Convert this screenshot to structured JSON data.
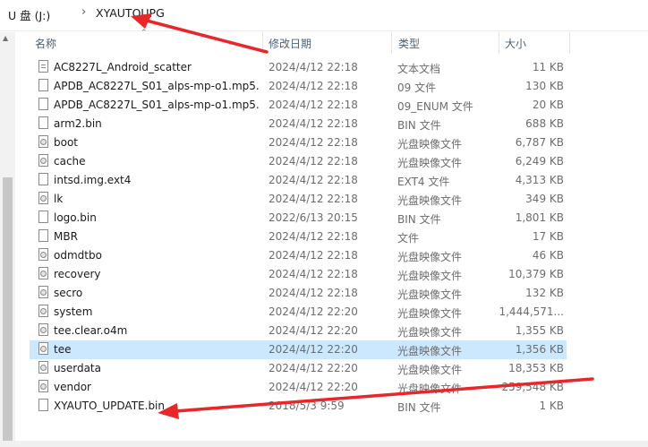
{
  "breadcrumb": {
    "drive": "U 盘 (J:)",
    "separator": "›",
    "folder": "XYAUTOUPG"
  },
  "columns": {
    "name": "名称",
    "date": "修改日期",
    "type": "类型",
    "size": "大小"
  },
  "files": [
    {
      "name": "AC8227L_Android_scatter",
      "date": "2024/4/12 22:18",
      "type": "文本文档",
      "size": "11 KB",
      "icon": "text-doc-icon"
    },
    {
      "name": "APDB_AC8227L_S01_alps-mp-o1.mp5...",
      "date": "2024/4/12 22:18",
      "type": "09 文件",
      "size": "130 KB",
      "icon": "file-icon"
    },
    {
      "name": "APDB_AC8227L_S01_alps-mp-o1.mp5...",
      "date": "2024/4/12 22:18",
      "type": "09_ENUM 文件",
      "size": "20 KB",
      "icon": "file-icon"
    },
    {
      "name": "arm2.bin",
      "date": "2024/4/12 22:18",
      "type": "BIN 文件",
      "size": "688 KB",
      "icon": "file-icon"
    },
    {
      "name": "boot",
      "date": "2024/4/12 22:18",
      "type": "光盘映像文件",
      "size": "6,787 KB",
      "icon": "disc-image-icon"
    },
    {
      "name": "cache",
      "date": "2024/4/12 22:18",
      "type": "光盘映像文件",
      "size": "6,249 KB",
      "icon": "disc-image-icon"
    },
    {
      "name": "intsd.img.ext4",
      "date": "2024/4/12 22:18",
      "type": "EXT4 文件",
      "size": "4,313 KB",
      "icon": "file-icon"
    },
    {
      "name": "lk",
      "date": "2024/4/12 22:18",
      "type": "光盘映像文件",
      "size": "349 KB",
      "icon": "disc-image-icon"
    },
    {
      "name": "logo.bin",
      "date": "2022/6/13 20:15",
      "type": "BIN 文件",
      "size": "1,801 KB",
      "icon": "file-icon"
    },
    {
      "name": "MBR",
      "date": "2024/4/12 22:18",
      "type": "文件",
      "size": "17 KB",
      "icon": "file-icon"
    },
    {
      "name": "odmdtbo",
      "date": "2024/4/12 22:18",
      "type": "光盘映像文件",
      "size": "46 KB",
      "icon": "disc-image-icon"
    },
    {
      "name": "recovery",
      "date": "2024/4/12 22:18",
      "type": "光盘映像文件",
      "size": "10,379 KB",
      "icon": "disc-image-icon"
    },
    {
      "name": "secro",
      "date": "2024/4/12 22:18",
      "type": "光盘映像文件",
      "size": "132 KB",
      "icon": "disc-image-icon"
    },
    {
      "name": "system",
      "date": "2024/4/12 22:20",
      "type": "光盘映像文件",
      "size": "1,444,571...",
      "icon": "disc-image-icon"
    },
    {
      "name": "tee.clear.o4m",
      "date": "2024/4/12 22:20",
      "type": "光盘映像文件",
      "size": "1,355 KB",
      "icon": "disc-image-icon"
    },
    {
      "name": "tee",
      "date": "2024/4/12 22:20",
      "type": "光盘映像文件",
      "size": "1,356 KB",
      "icon": "disc-image-icon",
      "selected": true
    },
    {
      "name": "userdata",
      "date": "2024/4/12 22:20",
      "type": "光盘映像文件",
      "size": "18,353 KB",
      "icon": "disc-image-icon"
    },
    {
      "name": "vendor",
      "date": "2024/4/12 22:20",
      "type": "光盘映像文件",
      "size": "259,548 KB",
      "icon": "disc-image-icon"
    },
    {
      "name": "XYAUTO_UPDATE.bin",
      "date": "2018/5/3 9:59",
      "type": "BIN 文件",
      "size": "1 KB",
      "icon": "file-icon"
    }
  ],
  "colors": {
    "selection": "#cce8ff",
    "annotation_arrow": "#e8272b",
    "header_text": "#4c607a"
  }
}
